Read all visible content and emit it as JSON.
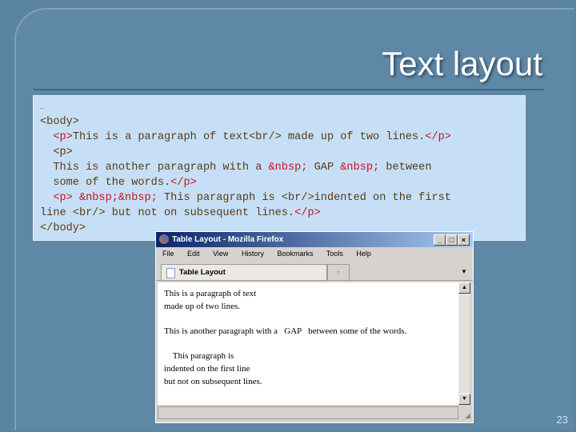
{
  "slide": {
    "title": "Text layout",
    "page_number": "23"
  },
  "code_lines": [
    [
      {
        "t": "…",
        "c": "n"
      }
    ],
    [
      {
        "t": "<body>",
        "c": "n"
      }
    ],
    [
      {
        "t": "  "
      },
      {
        "t": "<p>",
        "c": "r"
      },
      {
        "t": "This is a paragraph of text<br/> made up of two lines."
      },
      {
        "t": "</p>",
        "c": "r"
      }
    ],
    [
      {
        "t": "  <p>"
      }
    ],
    [
      {
        "t": "  This is another paragraph with a "
      },
      {
        "t": "&nbsp;",
        "c": "r"
      },
      {
        "t": " GAP "
      },
      {
        "t": "&nbsp;",
        "c": "r"
      },
      {
        "t": " between"
      }
    ],
    [
      {
        "t": "  some of the words."
      },
      {
        "t": "</p>",
        "c": "r"
      }
    ],
    [
      {
        "t": "  "
      },
      {
        "t": "<p> &nbsp;&nbsp;",
        "c": "r"
      },
      {
        "t": " This paragraph is <br/>indented on the first"
      }
    ],
    [
      {
        "t": "line <br/> but not on subsequent lines."
      },
      {
        "t": "</p>",
        "c": "r"
      }
    ],
    [
      {
        "t": "</body>"
      }
    ]
  ],
  "browser": {
    "window_title": "Table Layout - Mozilla Firefox",
    "menu": [
      "File",
      "Edit",
      "View",
      "History",
      "Bookmarks",
      "Tools",
      "Help"
    ],
    "tab_label": "Table Layout",
    "content": [
      "This is a paragraph of text\nmade up of two lines.",
      "This is another paragraph with a   GAP   between some of the words.",
      "    This paragraph is\nindented on the first line\nbut not on subsequent lines."
    ]
  }
}
